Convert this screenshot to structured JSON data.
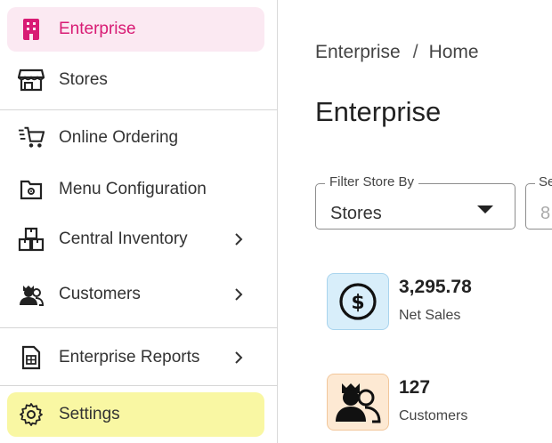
{
  "sidebar": {
    "items": [
      {
        "label": "Enterprise",
        "icon": "building-icon"
      },
      {
        "label": "Stores",
        "icon": "store-icon"
      },
      {
        "label": "Online Ordering",
        "icon": "cart-icon"
      },
      {
        "label": "Menu Configuration",
        "icon": "menu-config-icon"
      },
      {
        "label": "Central Inventory",
        "icon": "inventory-icon"
      },
      {
        "label": "Customers",
        "icon": "customers-icon"
      },
      {
        "label": "Enterprise Reports",
        "icon": "report-icon"
      },
      {
        "label": "Settings",
        "icon": "gear-icon"
      }
    ]
  },
  "breadcrumb": {
    "root": "Enterprise",
    "separator": "/",
    "current": "Home"
  },
  "page_title": "Enterprise",
  "filters": {
    "store_filter": {
      "legend": "Filter Store By",
      "value": "Stores"
    },
    "second_filter": {
      "legend": "Se",
      "value": "8"
    }
  },
  "stats": {
    "net_sales": {
      "value": "3,295.78",
      "caption": "Net Sales",
      "icon": "dollar-icon"
    },
    "customers": {
      "value": "127",
      "caption": "Customers",
      "icon": "customers-icon"
    }
  },
  "colors": {
    "accent": "#d81b74",
    "active_bg": "#fbe9f2",
    "settings_bg": "#f9f7a3",
    "sales_badge_bg": "#d8eefa",
    "customers_badge_bg": "#fde9d3"
  }
}
